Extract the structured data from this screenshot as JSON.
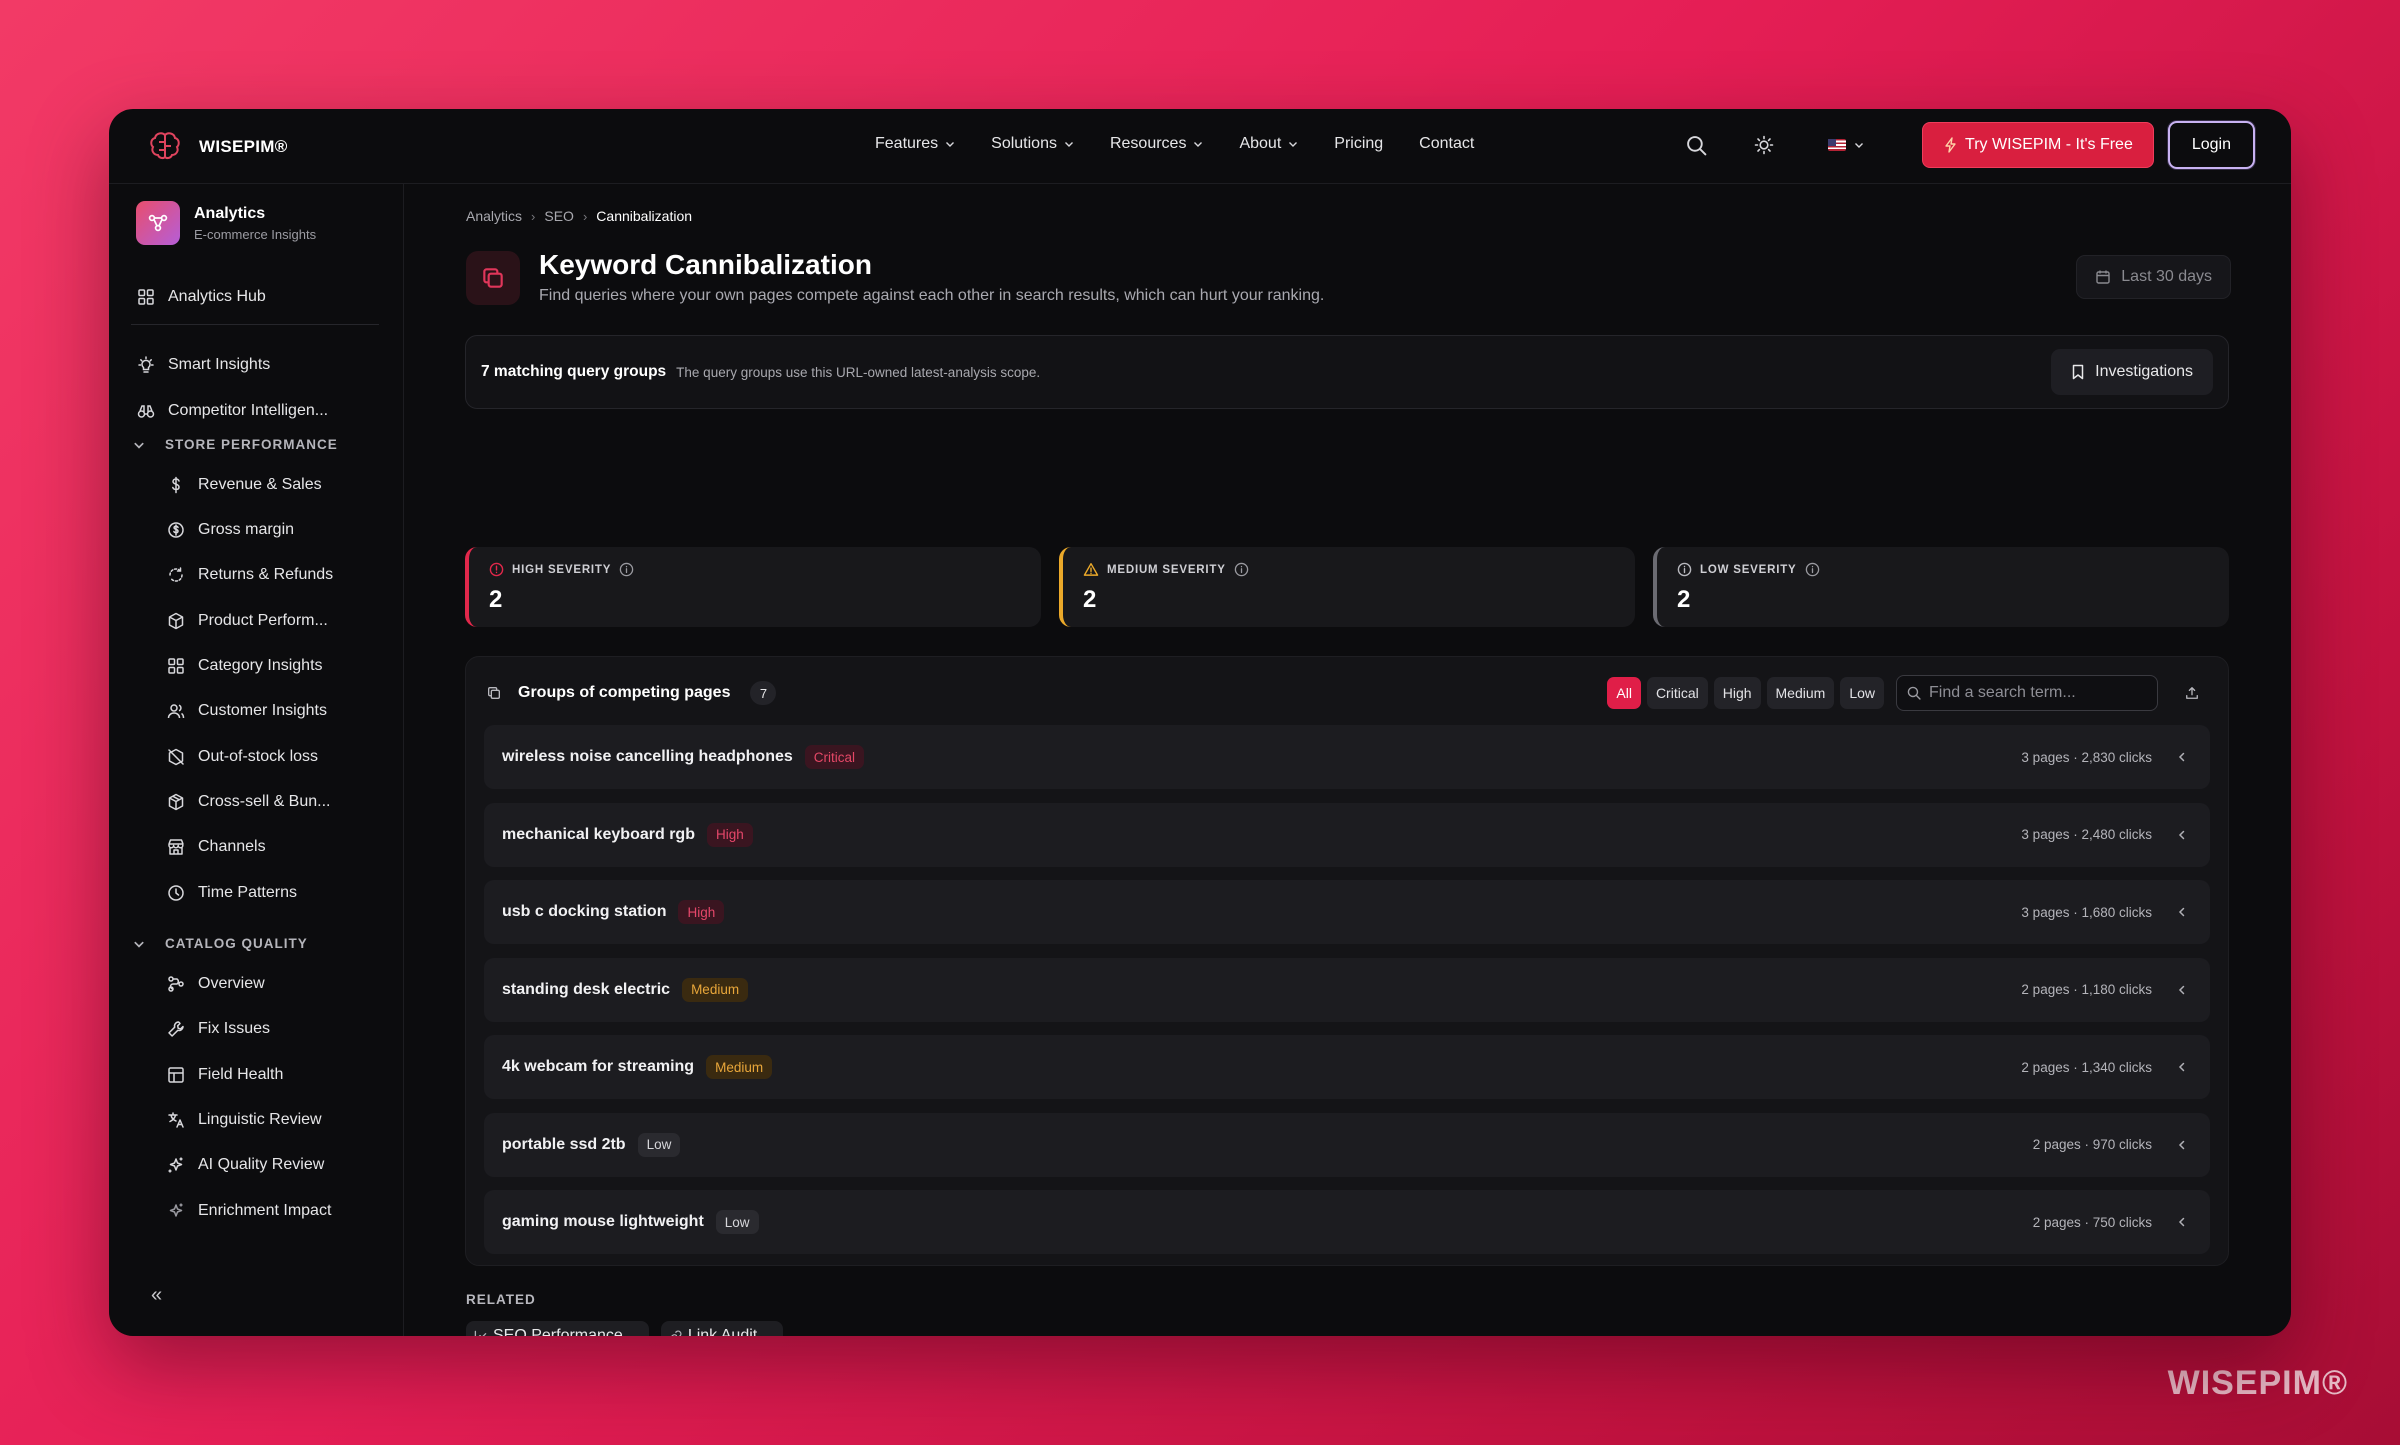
{
  "brand": {
    "name": "WISEPIM®"
  },
  "watermark": "WISEPIM®",
  "nav": {
    "links": [
      {
        "label": "Features",
        "dropdown": true
      },
      {
        "label": "Solutions",
        "dropdown": true
      },
      {
        "label": "Resources",
        "dropdown": true
      },
      {
        "label": "About",
        "dropdown": true
      },
      {
        "label": "Pricing",
        "dropdown": false
      },
      {
        "label": "Contact",
        "dropdown": false
      }
    ],
    "try_label": "Try WISEPIM - It's Free",
    "login_label": "Login"
  },
  "sidebar": {
    "app_title": "Analytics",
    "app_sub": "E-commerce Insights",
    "hub": "Analytics Hub",
    "top_items": [
      "Smart Insights",
      "Competitor Intelligen..."
    ],
    "store_section": "STORE PERFORMANCE",
    "store_items": [
      "Revenue & Sales",
      "Gross margin",
      "Returns & Refunds",
      "Product Perform...",
      "Category Insights",
      "Customer Insights",
      "Out-of-stock loss",
      "Cross-sell & Bun...",
      "Channels",
      "Time Patterns"
    ],
    "catalog_section": "CATALOG QUALITY",
    "catalog_items": [
      "Overview",
      "Fix Issues",
      "Field Health",
      "Linguistic Review",
      "AI Quality Review",
      "Enrichment Impact"
    ],
    "collapse": "«"
  },
  "breadcrumb": [
    "Analytics",
    "SEO",
    "Cannibalization"
  ],
  "page": {
    "title": "Keyword Cannibalization",
    "description": "Find queries where your own pages compete against each other in search results, which can hurt your ranking.",
    "date_range": "Last 30 days"
  },
  "scope": {
    "count": "7 matching query groups",
    "note": "The query groups use this URL-owned latest-analysis scope.",
    "investigations": "Investigations"
  },
  "severity": [
    {
      "label": "HIGH SEVERITY",
      "value": "2"
    },
    {
      "label": "MEDIUM SEVERITY",
      "value": "2"
    },
    {
      "label": "LOW SEVERITY",
      "value": "2"
    }
  ],
  "groups": {
    "title": "Groups of competing pages",
    "count": "7",
    "filters": [
      "All",
      "Critical",
      "High",
      "Medium",
      "Low"
    ],
    "active_filter": "All",
    "search_placeholder": "Find a search term...",
    "rows": [
      {
        "query": "wireless noise cancelling headphones",
        "severity": "Critical",
        "meta": "3 pages · 2,830 clicks"
      },
      {
        "query": "mechanical keyboard rgb",
        "severity": "High",
        "meta": "3 pages · 2,480 clicks"
      },
      {
        "query": "usb c docking station",
        "severity": "High",
        "meta": "3 pages · 1,680 clicks"
      },
      {
        "query": "standing desk electric",
        "severity": "Medium",
        "meta": "2 pages · 1,180 clicks"
      },
      {
        "query": "4k webcam for streaming",
        "severity": "Medium",
        "meta": "2 pages · 1,340 clicks"
      },
      {
        "query": "portable ssd 2tb",
        "severity": "Low",
        "meta": "2 pages · 970 clicks"
      },
      {
        "query": "gaming mouse lightweight",
        "severity": "Low",
        "meta": "2 pages · 750 clicks"
      }
    ]
  },
  "related": {
    "label": "RELATED",
    "links": [
      "SEO Performance",
      "Link Audit"
    ]
  },
  "colors": {
    "accent": "#e01e48",
    "high": "#e2284b",
    "medium": "#eba92a",
    "low": "#6b6b72"
  }
}
